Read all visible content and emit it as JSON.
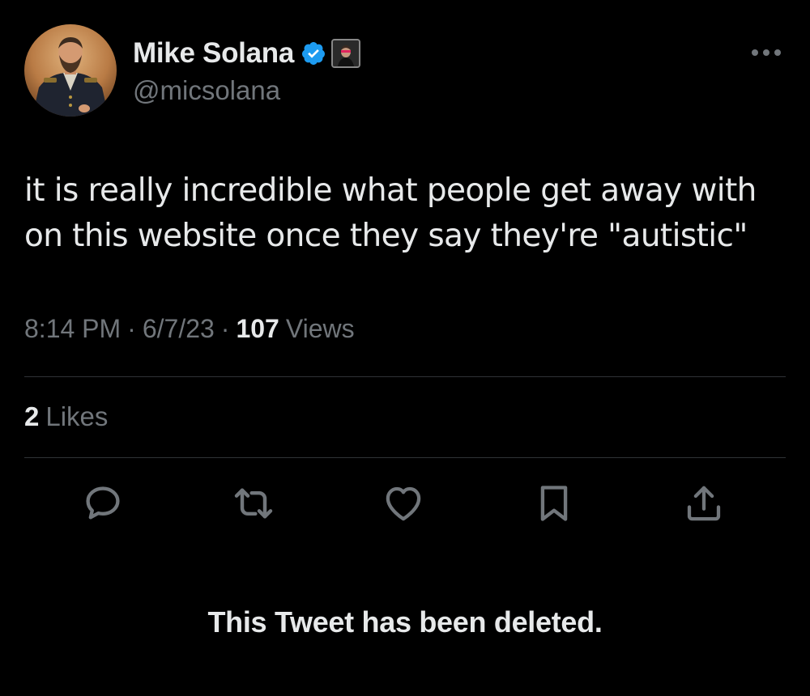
{
  "author": {
    "display_name": "Mike Solana",
    "handle": "@micsolana",
    "verified": true,
    "avatar_icon": "portrait-avatar",
    "affiliate_badge_icon": "affiliate-portrait-badge"
  },
  "tweet": {
    "text": "it is really incredible what people get away with\non this website once they say they're \"autistic\"",
    "time": "8:14 PM",
    "date": "6/7/23",
    "separator": "·",
    "views_count": "107",
    "views_label": "Views"
  },
  "engagement": {
    "likes_count": "2",
    "likes_label": "Likes"
  },
  "actions": [
    {
      "name": "reply",
      "icon": "reply-icon"
    },
    {
      "name": "retweet",
      "icon": "retweet-icon"
    },
    {
      "name": "like",
      "icon": "heart-icon"
    },
    {
      "name": "bookmark",
      "icon": "bookmark-icon"
    },
    {
      "name": "share",
      "icon": "share-icon"
    }
  ],
  "more_icon": "more-dots-icon",
  "notice": "This Tweet has been deleted.",
  "colors": {
    "background": "#000000",
    "text_primary": "#e7e9ea",
    "text_secondary": "#71767b",
    "divider": "#2f3336",
    "verified_blue": "#1d9bf0"
  }
}
